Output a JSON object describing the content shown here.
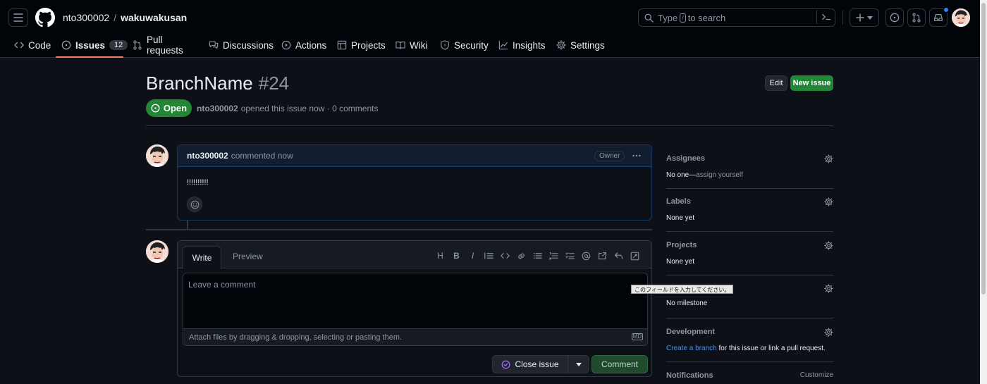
{
  "header": {
    "owner": "nto300002",
    "separator": "/",
    "repo": "wakuwakusan",
    "search_before": "Type",
    "search_key": "/",
    "search_after": "to search"
  },
  "nav": {
    "tabs": [
      {
        "label": "Code",
        "icon": "code-icon"
      },
      {
        "label": "Issues",
        "icon": "issue-opened-icon",
        "count": "12",
        "active": true
      },
      {
        "label": "Pull requests",
        "icon": "git-pull-request-icon"
      },
      {
        "label": "Discussions",
        "icon": "comment-discussion-icon"
      },
      {
        "label": "Actions",
        "icon": "play-icon"
      },
      {
        "label": "Projects",
        "icon": "table-icon"
      },
      {
        "label": "Wiki",
        "icon": "book-icon"
      },
      {
        "label": "Security",
        "icon": "shield-icon"
      },
      {
        "label": "Insights",
        "icon": "graph-icon"
      },
      {
        "label": "Settings",
        "icon": "gear-icon"
      }
    ]
  },
  "issue": {
    "title": "BranchName",
    "number": "#24",
    "edit_label": "Edit",
    "new_issue_label": "New issue",
    "state": "Open",
    "author": "nto300002",
    "meta_text": "opened this issue now · 0 comments"
  },
  "comment": {
    "author": "nto300002",
    "action": "commented now",
    "badge": "Owner",
    "body": "!!!!!!!!!!"
  },
  "editor": {
    "write_tab": "Write",
    "preview_tab": "Preview",
    "placeholder": "Leave a comment",
    "attach_text": "Attach files by dragging & dropping, selecting or pasting them.",
    "md_label": "MD",
    "close_issue_label": "Close issue",
    "comment_label": "Comment",
    "tooltip": "このフィールドを入力してください。",
    "toolbar": [
      "H",
      "B",
      "I"
    ]
  },
  "sidebar": {
    "assignees": {
      "title": "Assignees",
      "value_strong": "No one—",
      "value_muted": "assign yourself"
    },
    "labels": {
      "title": "Labels",
      "value": "None yet"
    },
    "projects": {
      "title": "Projects",
      "value": "None yet"
    },
    "milestone": {
      "value": "No milestone"
    },
    "development": {
      "title": "Development",
      "link": "Create a branch",
      "rest": "for this issue or link a pull request."
    },
    "notifications": {
      "title": "Notifications",
      "customize": "Customize"
    }
  },
  "colors": {
    "accent_green": "#238636",
    "link_blue": "#4493f8",
    "tab_underline": "#f78166",
    "notification_dot": "#2f81f7"
  }
}
